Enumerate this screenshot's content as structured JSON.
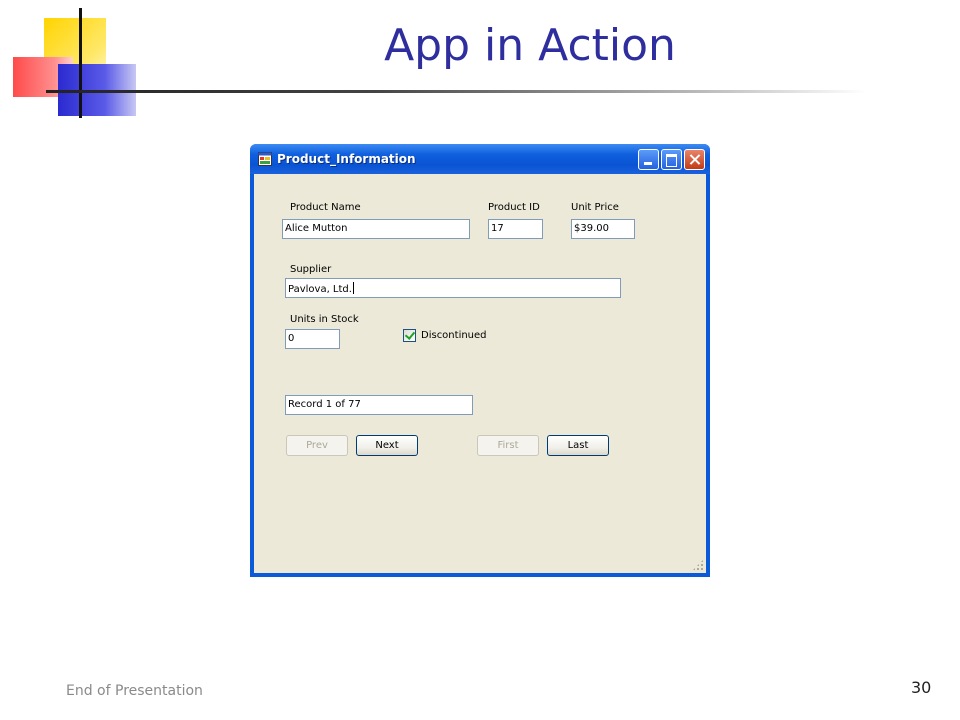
{
  "slide": {
    "title": "App in Action",
    "footer": "End of Presentation",
    "page_number": "30"
  },
  "window": {
    "title": "Product_Information",
    "icon": "app-window-icon",
    "controls": [
      "minimize-icon",
      "maximize-icon",
      "close-icon"
    ]
  },
  "form": {
    "product_name_label": "Product Name",
    "product_name_value": "Alice Mutton",
    "product_id_label": "Product ID",
    "product_id_value": "17",
    "unit_price_label": "Unit Price",
    "unit_price_value": "$39.00",
    "supplier_label": "Supplier",
    "supplier_value": "Pavlova, Ltd.",
    "units_in_stock_label": "Units in Stock",
    "units_in_stock_value": "0",
    "discontinued_label": "Discontinued",
    "discontinued_checked": true,
    "record_status": "Record 1 of 77"
  },
  "buttons": {
    "prev": "Prev",
    "next": "Next",
    "first": "First",
    "last": "Last"
  },
  "colors": {
    "title_text": "#2e2e9e",
    "titlebar": "#0a54d4",
    "client_background": "#ece9d8"
  }
}
